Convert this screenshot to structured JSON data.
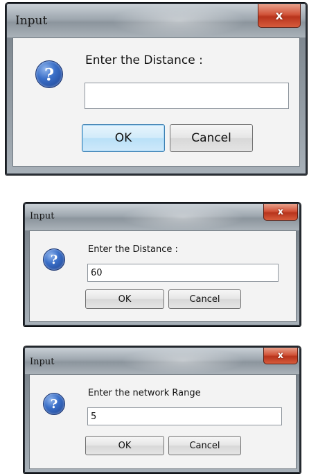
{
  "dialogs": [
    {
      "title": "Input",
      "close_label": "x",
      "icon": "question-icon",
      "icon_glyph": "?",
      "prompt": "Enter the Distance :",
      "input_value": "",
      "ok_label": "OK",
      "cancel_label": "Cancel"
    },
    {
      "title": "Input",
      "close_label": "x",
      "icon": "question-icon",
      "icon_glyph": "?",
      "prompt": "Enter the Distance :",
      "input_value": "60",
      "ok_label": "OK",
      "cancel_label": "Cancel"
    },
    {
      "title": "Input",
      "close_label": "x",
      "icon": "question-icon",
      "icon_glyph": "?",
      "prompt": "Enter the network Range",
      "input_value": "5",
      "ok_label": "OK",
      "cancel_label": "Cancel"
    }
  ],
  "colors": {
    "close_button": "#c8452a",
    "default_button_border": "#3c7fb1",
    "icon_blue": "#2a5fb8",
    "dialog_body": "#f3f3f3"
  }
}
